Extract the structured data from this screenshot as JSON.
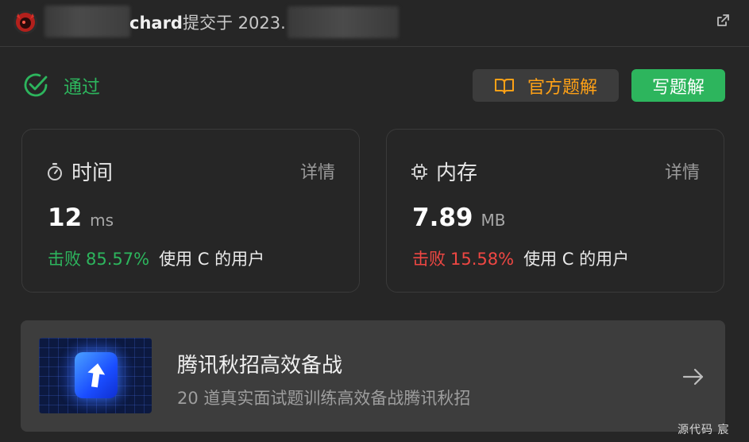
{
  "header": {
    "author": "chard",
    "submitted_prefix": "提交于 2023."
  },
  "status": {
    "label": "通过"
  },
  "actions": {
    "official_solution_label": "官方题解",
    "write_solution_label": "写题解"
  },
  "time_card": {
    "title": "时间",
    "detail_label": "详情",
    "value": "12",
    "unit": "ms",
    "beat_label": "击败",
    "beat_percent": "85.57%",
    "beat_suffix": "使用 C 的用户"
  },
  "memory_card": {
    "title": "内存",
    "detail_label": "详情",
    "value": "7.89",
    "unit": "MB",
    "beat_label": "击败",
    "beat_percent": "15.58%",
    "beat_suffix": "使用 C 的用户"
  },
  "banner": {
    "title": "腾讯秋招高效备战",
    "subtitle": "20 道真实面试题训练高效备战腾讯秋招"
  },
  "corner": {
    "text": "源代码 宸"
  },
  "colors": {
    "success": "#2db55d",
    "accent": "#ffa116",
    "danger": "#ef4743",
    "background": "#262626"
  }
}
